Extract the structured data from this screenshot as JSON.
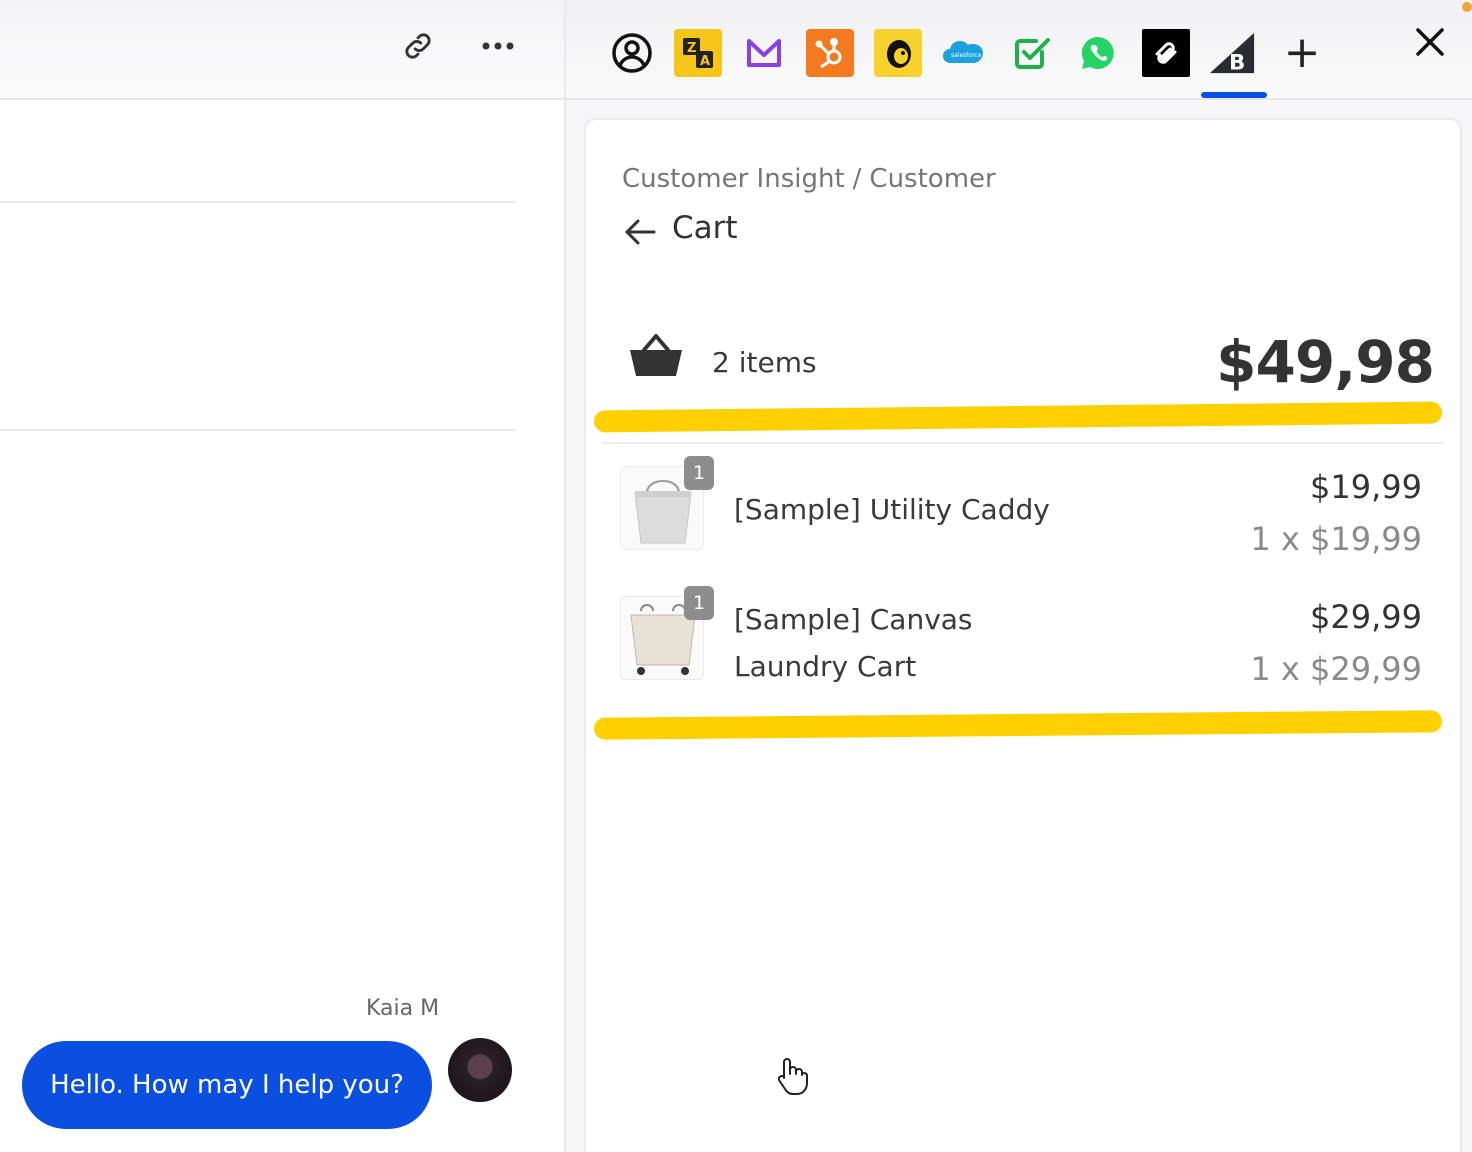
{
  "left_panel": {
    "agent_name": "Kaia M",
    "message": "Hello. How may I help you?",
    "icons": [
      "link-icon",
      "more-icon"
    ]
  },
  "toolbar": {
    "apps": [
      "contact-icon",
      "zendesk-translate-icon",
      "mailbox-icon",
      "hubspot-icon",
      "mailchimp-icon",
      "salesforce-icon",
      "task-check-icon",
      "whatsapp-icon",
      "squarespace-icon",
      "bigcommerce-icon"
    ],
    "active_app": "bigcommerce-icon",
    "add_label": "+",
    "close_icon": "close-icon"
  },
  "breadcrumb": {
    "parent": "Customer Insight",
    "separator": "/",
    "current": "Customer"
  },
  "cart": {
    "title": "Cart",
    "items_count": "2 items",
    "total": "$49,98",
    "products": [
      {
        "name": "[Sample] Utility Caddy",
        "quantity": "1",
        "price": "$19,99",
        "unit": "1 x $19,99"
      },
      {
        "name_line1": "[Sample] Canvas",
        "name_line2": "Laundry Cart",
        "quantity": "1",
        "price": "$29,99",
        "unit": "1 x $29,99"
      }
    ]
  },
  "colors": {
    "accent": "#0b4fe0",
    "highlight": "#ffd000",
    "zendesk": "#f5c518",
    "hubspot": "#f47a20",
    "mailchimp": "#f8d12d",
    "salesforce": "#1ca0e0",
    "whatsapp": "#25d366"
  }
}
